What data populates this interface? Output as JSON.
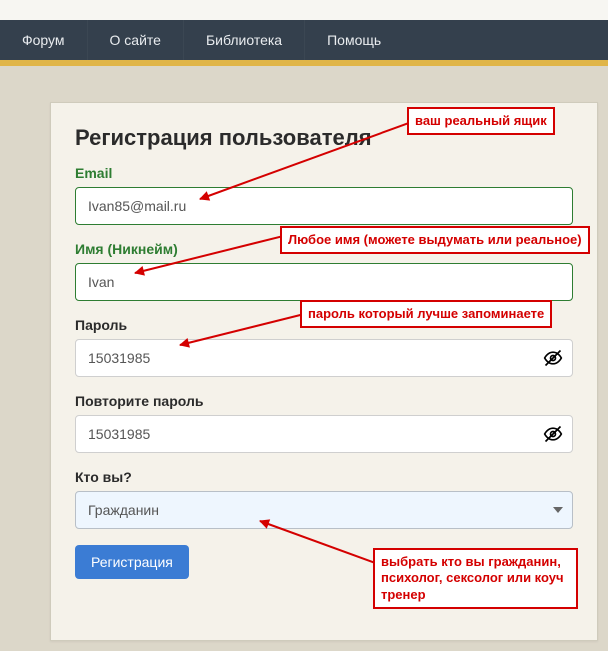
{
  "nav": {
    "items": [
      "Форум",
      "О сайте",
      "Библиотека",
      "Помощь"
    ]
  },
  "form": {
    "title": "Регистрация пользователя",
    "email_label": "Email",
    "email_value": "Ivan85@mail.ru",
    "name_label": "Имя (Никнейм)",
    "name_value": "Ivan",
    "password_label": "Пароль",
    "password_value": "15031985",
    "password2_label": "Повторите пароль",
    "password2_value": "15031985",
    "role_label": "Кто вы?",
    "role_value": "Гражданин",
    "submit": "Регистрация"
  },
  "ann": {
    "a1": "ваш реальный ящик",
    "a2": "Любое имя (можете выдумать или реальное)",
    "a3": "пароль который лучше запоминаете",
    "a4": "выбрать кто вы гражданин, психолог, сексолог или коуч тренер"
  }
}
